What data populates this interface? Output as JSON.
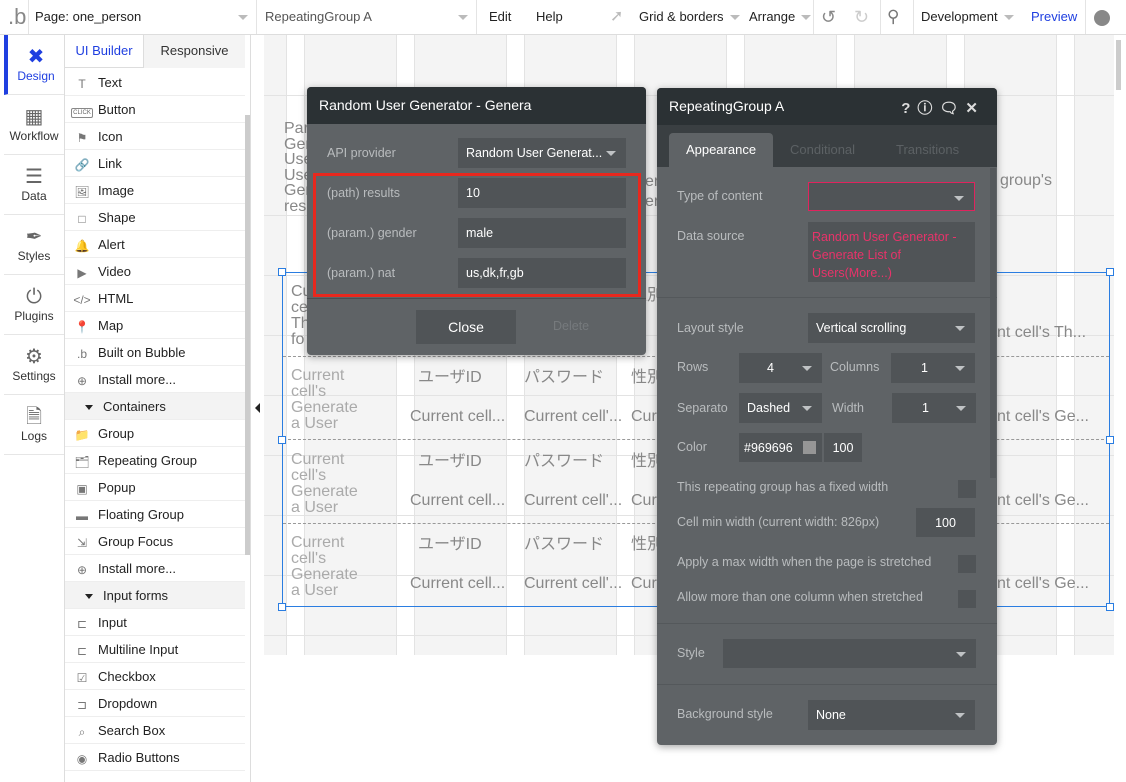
{
  "topbar": {
    "page_label": "Page: one_person",
    "element_label": "RepeatingGroup A",
    "edit": "Edit",
    "help": "Help",
    "grid": "Grid & borders",
    "arrange": "Arrange",
    "env": "Development",
    "preview": "Preview",
    "accent": "#1f3fe0"
  },
  "iconbar": [
    {
      "label": "Design",
      "icon": "design-icon"
    },
    {
      "label": "Workflow",
      "icon": "workflow-icon"
    },
    {
      "label": "Data",
      "icon": "database-icon"
    },
    {
      "label": "Styles",
      "icon": "brush-icon"
    },
    {
      "label": "Plugins",
      "icon": "plug-icon"
    },
    {
      "label": "Settings",
      "icon": "gear-icon"
    },
    {
      "label": "Logs",
      "icon": "document-icon"
    }
  ],
  "elpanel": {
    "tabs": [
      "UI Builder",
      "Responsive"
    ],
    "visual": [
      "Text",
      "Button",
      "Icon",
      "Link",
      "Image",
      "Shape",
      "Alert",
      "Video",
      "HTML",
      "Map",
      "Built on Bubble",
      "Install more..."
    ],
    "containers_label": "Containers",
    "containers": [
      "Group",
      "Repeating Group",
      "Popup",
      "Floating Group",
      "Group Focus",
      "Install more..."
    ],
    "inputs_label": "Input forms",
    "inputs": [
      "Input",
      "Multiline Input",
      "Checkbox",
      "Dropdown",
      "Search Box",
      "Radio Buttons"
    ],
    "button_icon_text": "CLICK"
  },
  "canvas": {
    "header_left": [
      "Par",
      "Gen",
      "Use",
      "Use",
      "Gen",
      "resu"
    ],
    "header_mid1": "jl",
    "header_mid2": "er",
    "header_mid3": "er",
    "header_right": "group's",
    "row1_left": [
      "Cu",
      "ce",
      "Th",
      "fo"
    ],
    "row1_col3": "性別",
    "row1_right": "nt cell's Th...",
    "rows": [
      {
        "left": [
          "Current",
          "cell's",
          "Generate",
          "a User"
        ],
        "h1": "ユーザID",
        "h2": "パスワード",
        "h3": "性別",
        "v1": "Current cell...",
        "v2": "Current cell'...",
        "v3": "Curr",
        "right": "nt cell's Ge..."
      },
      {
        "left": [
          "Current",
          "cell's",
          "Generate",
          "a User"
        ],
        "h1": "ユーザID",
        "h2": "パスワード",
        "h3": "性別",
        "v1": "Current cell...",
        "v2": "Current cell'...",
        "v3": "Curr",
        "right": "nt cell's Ge..."
      },
      {
        "left": [
          "Current",
          "cell's",
          "Generate",
          "a User"
        ],
        "h1": "ユーザID",
        "h2": "パスワード",
        "h3": "性別",
        "v1": "Current cell...",
        "v2": "Current cell'...",
        "v3": "Curr",
        "right": "nt cell's Ge..."
      }
    ]
  },
  "api_dialog": {
    "title": "Random User Generator - Genera",
    "provider_label": "API provider",
    "provider_value": "Random User Generat...",
    "params": [
      {
        "label": "(path) results",
        "value": "10"
      },
      {
        "label": "(param.) gender",
        "value": "male"
      },
      {
        "label": "(param.) nat",
        "value": "us,dk,fr,gb"
      }
    ],
    "close": "Close",
    "delete": "Delete",
    "highlight_color": "#e8281e"
  },
  "props": {
    "title": "RepeatingGroup A",
    "tabs": [
      "Appearance",
      "Conditional",
      "Transitions"
    ],
    "type_of_content_label": "Type of content",
    "type_of_content_value": "",
    "data_source_label": "Data source",
    "data_source_value": "Random User Generator - Generate List of Users(More...)",
    "layout_label": "Layout style",
    "layout_value": "Vertical scrolling",
    "rows_label": "Rows",
    "rows_value": "4",
    "columns_label": "Columns",
    "columns_value": "1",
    "separator_label": "Separato",
    "separator_value": "Dashed",
    "width_label": "Width",
    "width_value": "1",
    "color_label": "Color",
    "color_value": "#969696",
    "opacity": "100",
    "fixed_width_label": "This repeating group has a fixed width",
    "fixed_width": false,
    "cell_min_label": "Cell min width (current width: 826px)",
    "cell_min_value": "100",
    "max_width_label": "Apply a max width when the page is stretched",
    "max_width": false,
    "multi_col_label": "Allow more than one column when stretched",
    "multi_col": false,
    "style_label": "Style",
    "style_value": "",
    "bg_label": "Background style",
    "bg_value": "None",
    "error_color": "#e8336a"
  }
}
